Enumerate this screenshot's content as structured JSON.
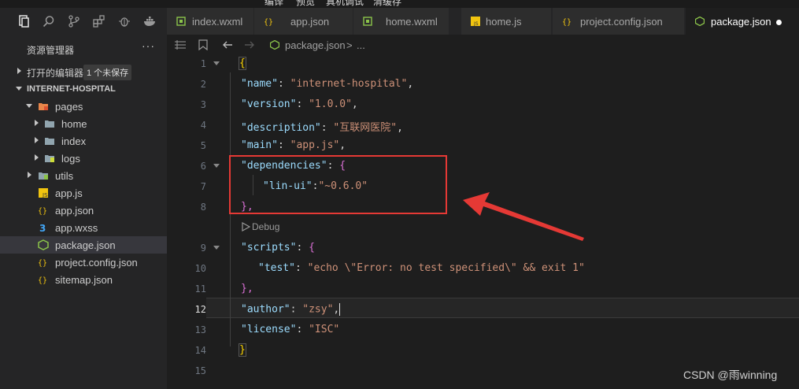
{
  "menu": [
    "编译",
    "预览",
    "真机调试",
    "清缓存"
  ],
  "activity_icons": [
    "explorer-icon",
    "search-icon",
    "source-control-icon",
    "extensions-icon",
    "debug-icon",
    "docker-icon"
  ],
  "sidebar": {
    "title": "资源管理器",
    "more": "···",
    "open_editors": "打开的编辑器",
    "unsaved_badge": "1 个未保存",
    "project": "INTERNET-HOSPITAL",
    "tree": [
      {
        "label": "pages",
        "type": "folder-pages"
      },
      {
        "label": "home",
        "type": "folder"
      },
      {
        "label": "index",
        "type": "folder"
      },
      {
        "label": "logs",
        "type": "folder-logs"
      },
      {
        "label": "utils",
        "type": "folder-utils"
      },
      {
        "label": "app.js",
        "type": "js"
      },
      {
        "label": "app.json",
        "type": "json"
      },
      {
        "label": "app.wxss",
        "type": "css"
      },
      {
        "label": "package.json",
        "type": "node"
      },
      {
        "label": "project.config.json",
        "type": "json"
      },
      {
        "label": "sitemap.json",
        "type": "json"
      }
    ]
  },
  "tabs": [
    {
      "label": "index.wxml"
    },
    {
      "label": "app.json"
    },
    {
      "label": "home.wxml"
    },
    {
      "label": "home.js"
    },
    {
      "label": "project.config.json"
    },
    {
      "label": "package.json"
    }
  ],
  "breadcrumb": {
    "file": "package.json",
    "sep": ">",
    "more": "..."
  },
  "editor": {
    "line_numbers": [
      "1",
      "2",
      "3",
      "4",
      "5",
      "6",
      "7",
      "8",
      "9",
      "10",
      "11",
      "12",
      "13",
      "14",
      "15"
    ],
    "current_line": "12",
    "codelens": "Debug",
    "strings": {
      "open": "{",
      "close": "}",
      "name_k": "\"name\"",
      "name_v": "\"internet-hospital\"",
      "version_k": "\"version\"",
      "version_v": "\"1.0.0\"",
      "desc_k": "\"description\"",
      "desc_v": "\"互联网医院\"",
      "main_k": "\"main\"",
      "main_v": "\"app.js\"",
      "deps_k": "\"dependencies\"",
      "lin_k": "\"lin-ui\"",
      "lin_v": "\"~0.6.0\"",
      "deps_close": "},",
      "scripts_k": "\"scripts\"",
      "test_k": "\"test\"",
      "test_v": "\"echo \\\"Error: no test specified\\\" && exit 1\"",
      "scripts_close": "},",
      "author_k": "\"author\"",
      "author_v": "\"zsy\"",
      "license_k": "\"license\"",
      "license_v": "\"ISC\"",
      "colon": ": ",
      "comma": ",",
      "ob": "{"
    }
  },
  "watermark": "CSDN @雨winning",
  "colors": {
    "highlight": "#e53935",
    "key": "#9cdcfe",
    "string": "#ce9178"
  }
}
